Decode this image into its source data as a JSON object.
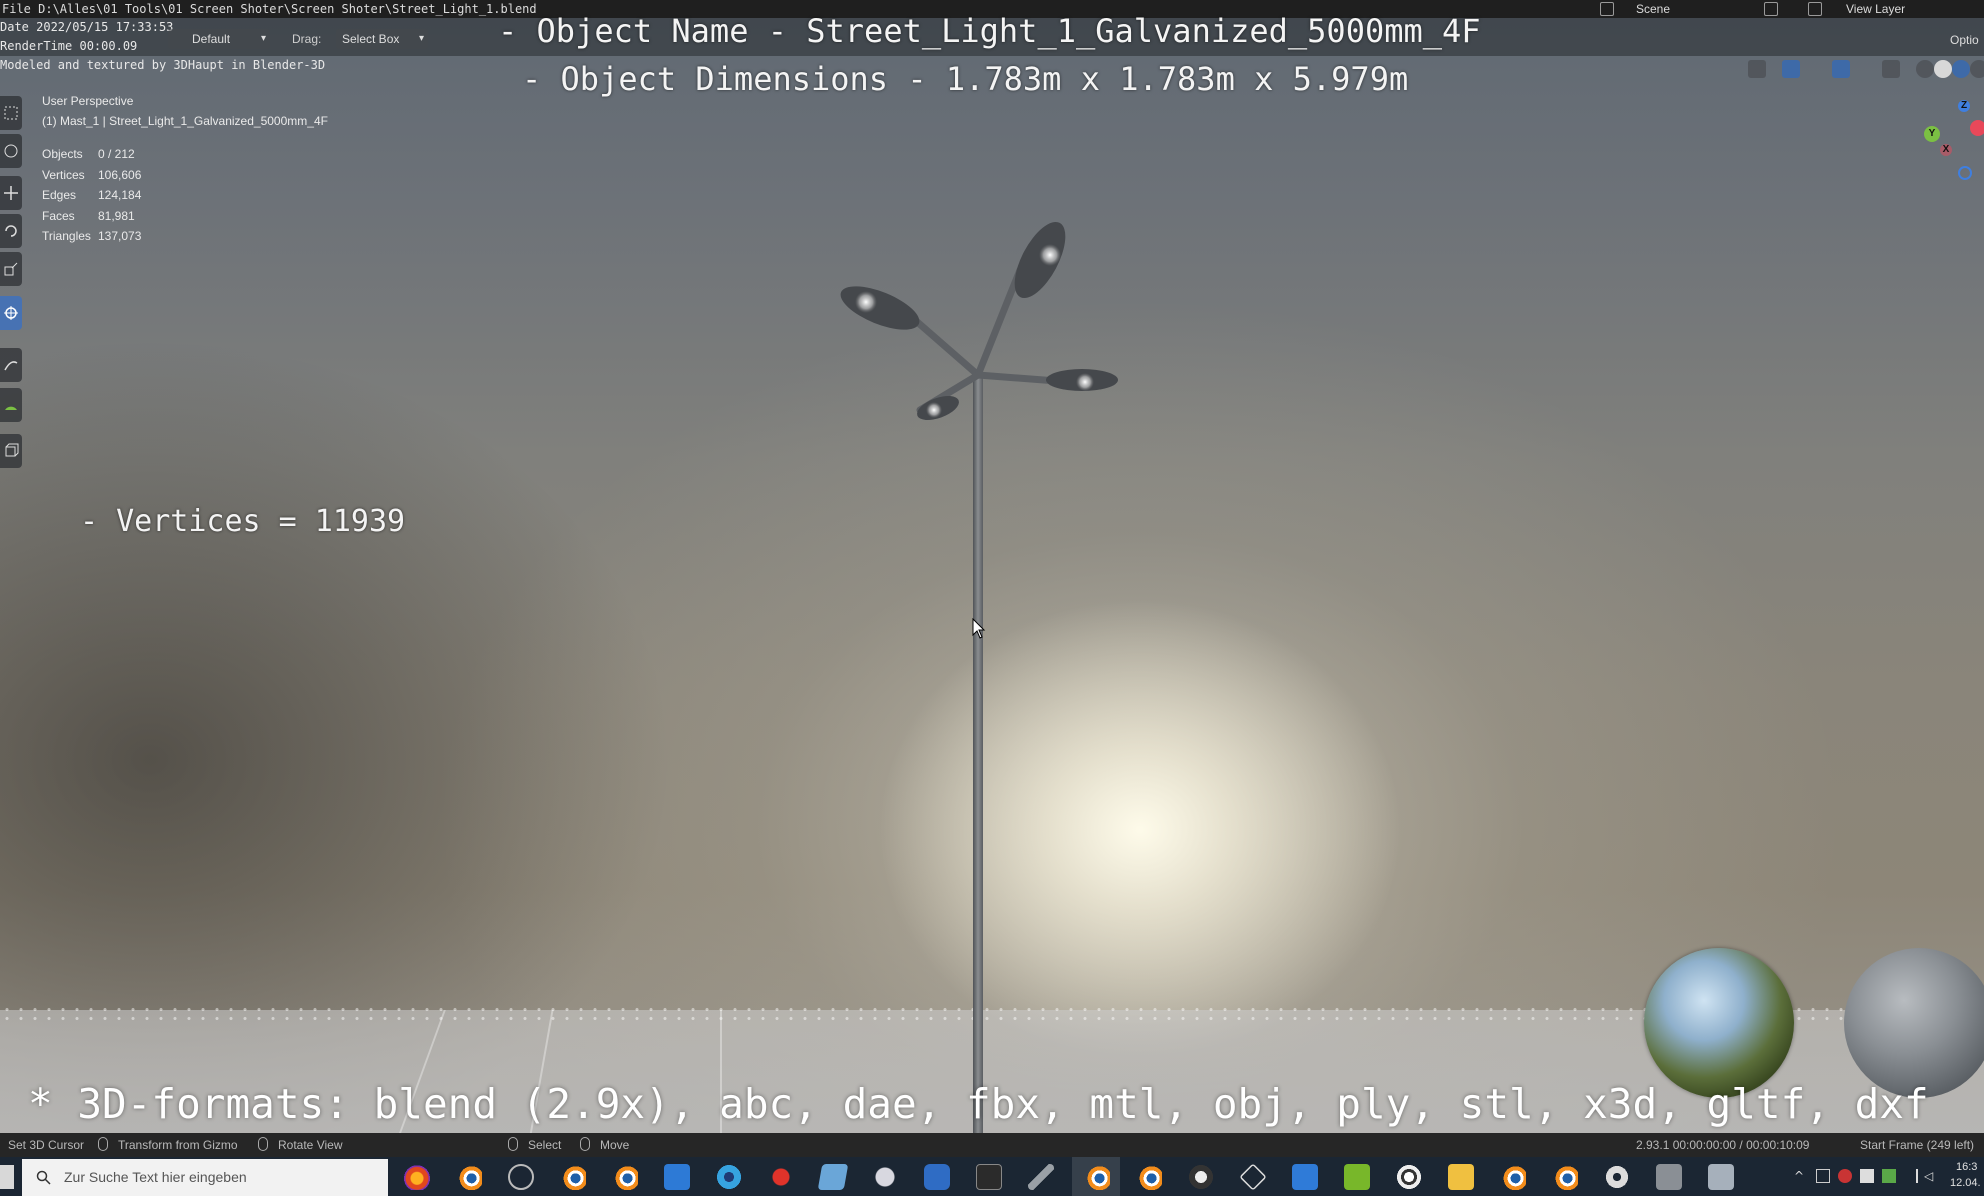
{
  "window": {
    "file_path": "File D:\\Alles\\01 Tools\\01 Screen Shoter\\Screen Shoter\\Street_Light_1.blend",
    "scene_label": "Scene",
    "view_layer_label": "View Layer",
    "options_label": "Optio"
  },
  "metadata_overlay": {
    "date": "Date 2022/05/15 17:33:53",
    "render_time": "RenderTime 00:00.09",
    "modeled_by": "Modeled and textured by 3DHaupt in Blender-3D"
  },
  "header": {
    "orientation_value": "Default",
    "drag_label": "Drag:",
    "drag_value": "Select Box"
  },
  "overlay_text": {
    "object_name": "- Object Name - Street_Light_1_Galvanized_5000mm_4F",
    "object_dimensions": "- Object Dimensions -  1.783m x 1.783m x 5.979m",
    "vertices": "- Vertices = 11939",
    "formats": "* 3D-formats: blend (2.9x), abc, dae, fbx, mtl, obj, ply, stl, x3d, gltf, dxf"
  },
  "viewport": {
    "perspective_label": "User Perspective",
    "active_object": "(1) Mast_1 | Street_Light_1_Galvanized_5000mm_4F"
  },
  "stats": [
    {
      "label": "Objects",
      "value": "0 / 212"
    },
    {
      "label": "Vertices",
      "value": "106,606"
    },
    {
      "label": "Edges",
      "value": "124,184"
    },
    {
      "label": "Faces",
      "value": "81,981"
    },
    {
      "label": "Triangles",
      "value": "137,073"
    }
  ],
  "gizmo": {
    "x": "X",
    "y": "Y",
    "z": "Z"
  },
  "statusbar": {
    "set_cursor": "Set 3D Cursor",
    "transform_gizmo": "Transform from Gizmo",
    "rotate_view": "Rotate View",
    "select": "Select",
    "move": "Move",
    "version_time": "2.93.1  00:00:00:00 / 00:00:10:09",
    "start_frame": "Start Frame (249 left)"
  },
  "taskbar": {
    "search_placeholder": "Zur Suche Text hier eingeben",
    "clock_time": "16:3",
    "clock_date": "12.04."
  },
  "colors": {
    "active_tool": "#4772b3",
    "axis_x": "#e8485a",
    "axis_y": "#7bc043",
    "axis_z": "#3f7fe0"
  }
}
